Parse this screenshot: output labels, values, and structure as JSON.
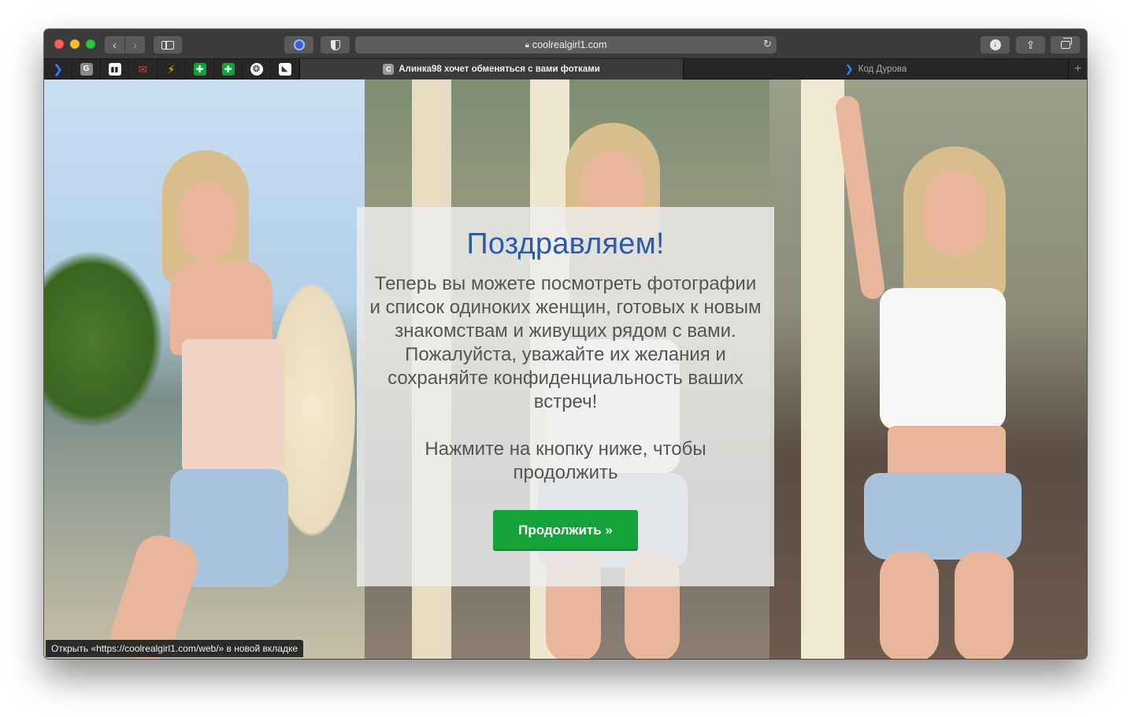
{
  "browser": {
    "address": "coolrealgirl1.com",
    "icons": {
      "back": "chevron-left-icon",
      "forward": "chevron-right-icon",
      "sidebar": "sidebar-icon",
      "extension": "circle-extension-icon",
      "shield": "shield-icon",
      "lock": "lock-icon",
      "reload": "reload-icon",
      "download": "download-icon",
      "share": "share-icon",
      "tabs": "tab-overview-icon"
    },
    "pinned_tabs": [
      {
        "icon": "chevron-icon",
        "glyph": "❯"
      },
      {
        "icon": "g-icon",
        "glyph": "G"
      },
      {
        "icon": "bar-chart-icon",
        "glyph": "▮▮"
      },
      {
        "icon": "mail-icon",
        "glyph": "✉"
      },
      {
        "icon": "zigzag-icon",
        "glyph": "⚡"
      },
      {
        "icon": "green-cross-icon",
        "glyph": "✚"
      },
      {
        "icon": "green-cross-icon",
        "glyph": "✚"
      },
      {
        "icon": "snake-icon",
        "glyph": "❂"
      },
      {
        "icon": "n-icon",
        "glyph": "◣"
      }
    ],
    "tabs": [
      {
        "favicon": "C",
        "title": "Алинка98 хочет обменяться с вами фотками",
        "active": true
      },
      {
        "favicon": "❯",
        "title": "Код Дурова",
        "active": false
      }
    ],
    "new_tab_glyph": "+"
  },
  "page": {
    "title": "Поздравляем!",
    "message": "Теперь вы можете посмотреть фотографии и список одиноких женщин, готовых к новым знакомствам и живущих рядом с вами. Пожалуйста, уважайте их желания и сохраняйте конфиденциальность ваших встреч!",
    "cta_text": "Нажмите на кнопку ниже, чтобы продолжить",
    "button_label": "Продолжить »",
    "button_color": "#13a338",
    "title_color": "#2f5aac"
  },
  "status_bar": "Открыть «https://coolrealgirl1.com/web/» в новой вкладке"
}
